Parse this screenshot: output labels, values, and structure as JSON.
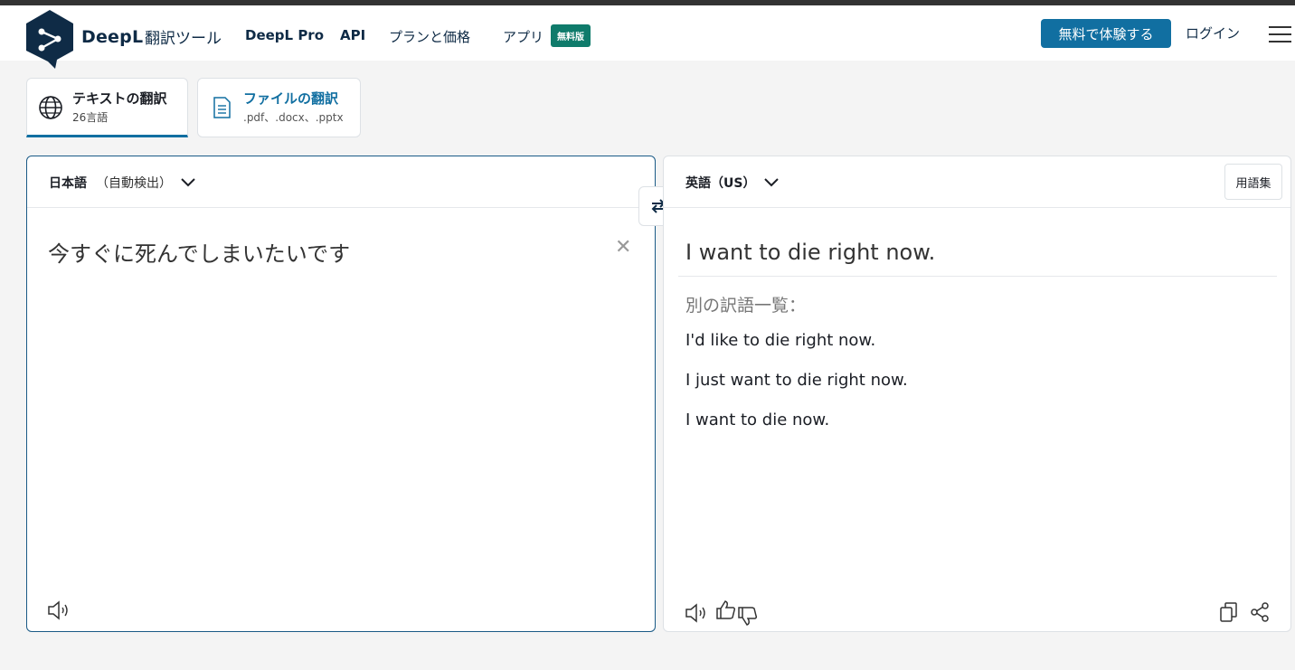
{
  "header": {
    "brand": "DeepL",
    "brand_sub": "翻訳ツール",
    "nav_pro": "DeepL Pro",
    "nav_api": "API",
    "nav_plans": "プランと価格",
    "nav_apps": "アプリ",
    "apps_badge": "無料版",
    "trial_button": "無料で体験する",
    "login": "ログイン"
  },
  "tabs": [
    {
      "title": "テキストの翻訳",
      "subtitle": "26言語",
      "icon": "globe-icon",
      "active": true
    },
    {
      "title": "ファイルの翻訳",
      "subtitle": ".pdf、.docx、.pptx",
      "icon": "document-icon",
      "active": false
    }
  ],
  "source": {
    "language": "日本語",
    "detect_note": "（自動検出）",
    "text": "今すぐに死んでしまいたいです"
  },
  "target": {
    "language": "英語（US）",
    "glossary_button": "用語集",
    "translation": "I want to die right now.",
    "alternatives_heading": "別の訳語一覧：",
    "alternatives": [
      "I'd like to die right now.",
      "I just want to die right now.",
      "I want to die now."
    ]
  },
  "colors": {
    "brand_navy": "#0f2b46",
    "accent_blue": "#116fa1",
    "badge_green": "#0f7b6b"
  }
}
